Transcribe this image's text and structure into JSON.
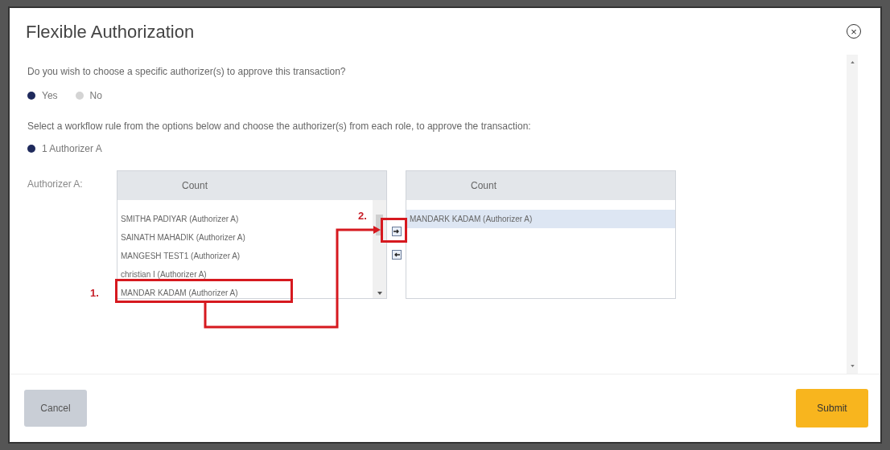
{
  "dialog": {
    "title": "Flexible Authorization",
    "close": "×"
  },
  "question": "Do you wish to choose a specific authorizer(s) to approve this transaction?",
  "choices": [
    {
      "label": "Yes",
      "selected": true
    },
    {
      "label": "No",
      "selected": false
    }
  ],
  "instruction": "Select a workflow rule from the options below and choose the authorizer(s) from each role, to approve the transaction:",
  "rules": [
    {
      "label": "1 Authorizer A",
      "selected": true
    }
  ],
  "authorizer_label": "Authorizer A:",
  "available_list": {
    "header": "Count",
    "items": [
      {
        "label": "SMITHA PADIYAR (Authorizer A)",
        "selected": false
      },
      {
        "label": "SAINATH MAHADIK (Authorizer A)",
        "selected": false
      },
      {
        "label": "MANGESH TEST1 (Authorizer A)",
        "selected": false
      },
      {
        "label": "christian I (Authorizer A)",
        "selected": false
      },
      {
        "label": "MANDAR KADAM (Authorizer A)",
        "selected": false
      }
    ]
  },
  "selected_list": {
    "header": "Count",
    "items": [
      {
        "label": "MANDARK KADAM (Authorizer A)",
        "selected": true
      }
    ]
  },
  "annotations": [
    {
      "label": "1."
    },
    {
      "label": "2."
    }
  ],
  "buttons": [
    {
      "label": "Cancel",
      "kind": "secondary"
    },
    {
      "label": "Submit",
      "kind": "primary"
    }
  ]
}
